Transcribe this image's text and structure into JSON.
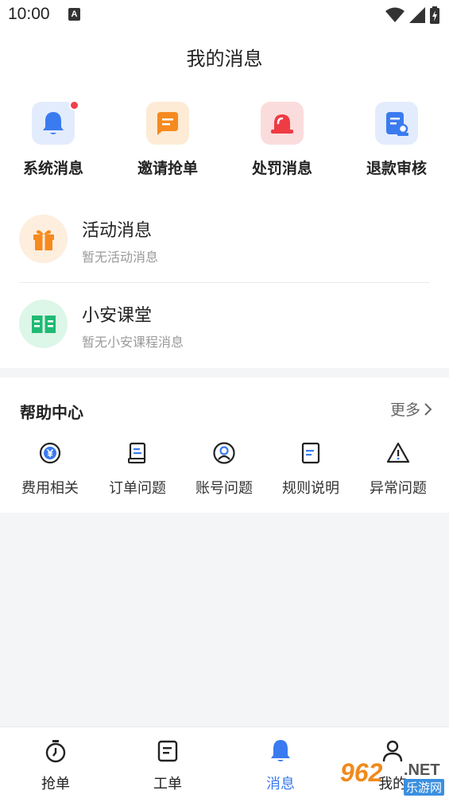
{
  "status": {
    "time": "10:00",
    "a_badge": "A"
  },
  "header": {
    "title": "我的消息"
  },
  "categories": [
    {
      "label": "系统消息",
      "icon": "bell-icon",
      "color": "#3a7bf0",
      "bg": "#e3ecfd",
      "has_dot": true
    },
    {
      "label": "邀请抢单",
      "icon": "chat-icon",
      "color": "#f58a1f",
      "bg": "#fdebd6"
    },
    {
      "label": "处罚消息",
      "icon": "alarm-icon",
      "color": "#ee3b44",
      "bg": "#fbdcdd"
    },
    {
      "label": "退款审核",
      "icon": "document-check-icon",
      "color": "#3a7bf0",
      "bg": "#e3ecfd"
    }
  ],
  "messages": [
    {
      "title": "活动消息",
      "subtitle": "暂无活动消息",
      "icon": "gift-icon",
      "color": "#f58a1f",
      "bg": "#fdeede"
    },
    {
      "title": "小安课堂",
      "subtitle": "暂无小安课程消息",
      "icon": "book-icon",
      "color": "#1fba73",
      "bg": "#dcf6e8"
    }
  ],
  "help": {
    "title": "帮助中心",
    "more": "更多",
    "items": [
      {
        "label": "费用相关",
        "icon": "yen-icon"
      },
      {
        "label": "订单问题",
        "icon": "order-icon"
      },
      {
        "label": "账号问题",
        "icon": "user-icon"
      },
      {
        "label": "规则说明",
        "icon": "rules-icon"
      },
      {
        "label": "异常问题",
        "icon": "warning-icon"
      }
    ]
  },
  "tabs": [
    {
      "label": "抢单",
      "icon": "stopwatch-icon",
      "active": false
    },
    {
      "label": "工单",
      "icon": "worksheet-icon",
      "active": false
    },
    {
      "label": "消息",
      "icon": "bell-icon",
      "active": true
    },
    {
      "label": "我的",
      "icon": "profile-icon",
      "active": false
    }
  ],
  "watermark": {
    "number": "962",
    "net": ".NET",
    "cn": "乐游网"
  },
  "colors": {
    "accent": "#3a7bf0",
    "red_dot": "#f0404a"
  }
}
